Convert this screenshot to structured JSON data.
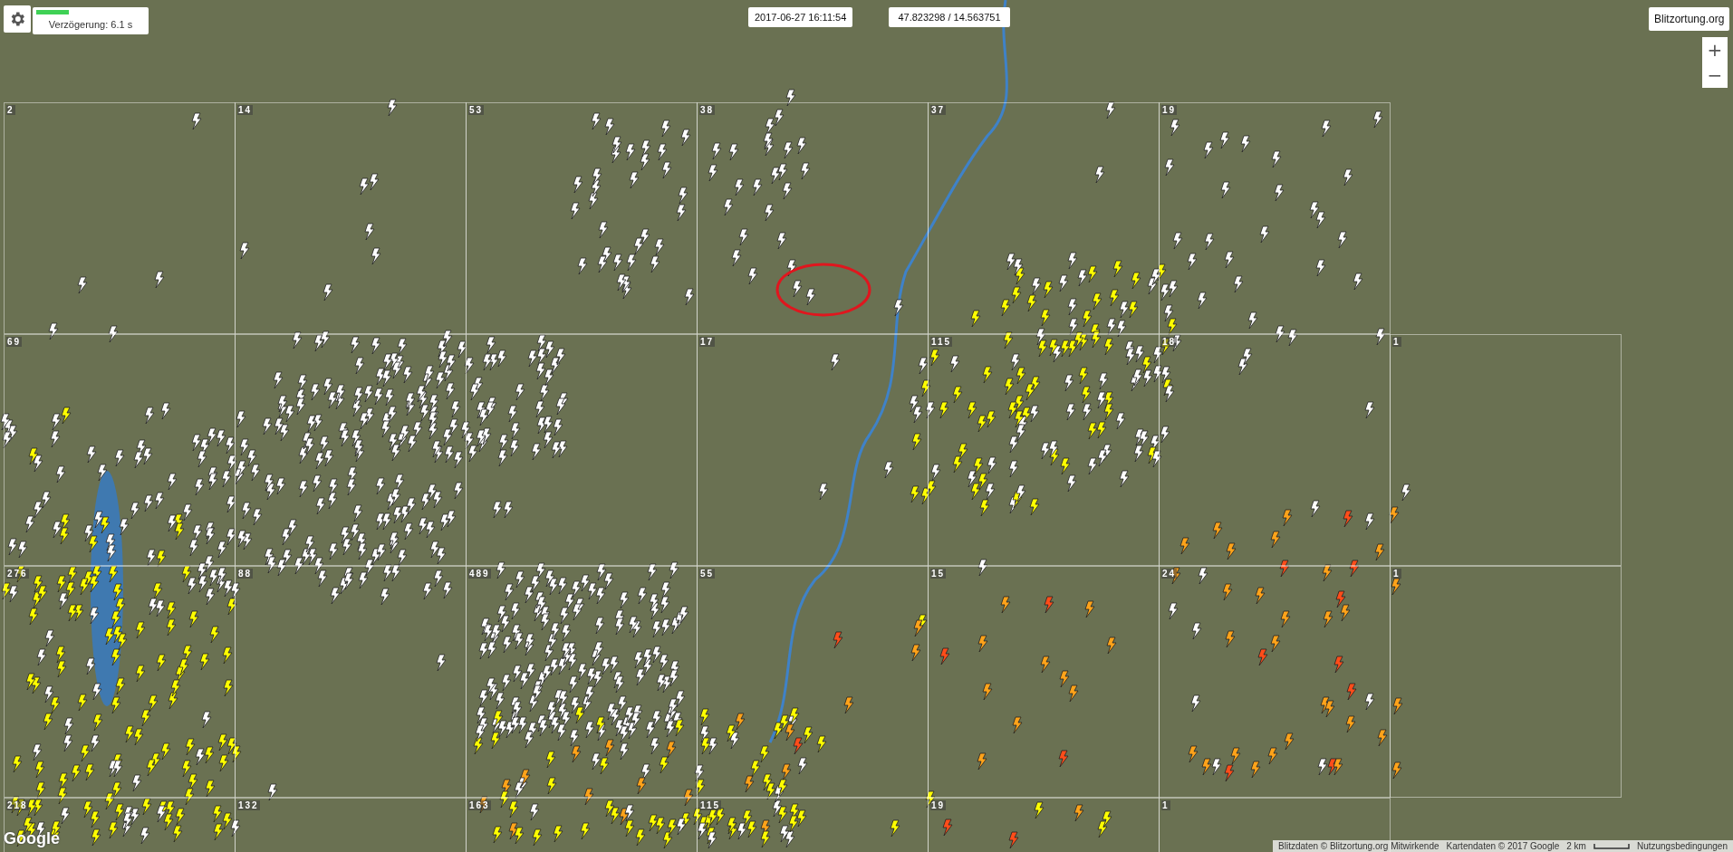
{
  "delay": {
    "label": "Verzögerung: 6.1 s",
    "level": 0.3
  },
  "timestamp": "2017-06-27 16:11:54",
  "coordinates": "47.823298 / 14.563751",
  "brand": "Blitzortung.org",
  "zoom_buttons": [
    "+",
    "−"
  ],
  "grid": {
    "rows": [
      {
        "cells": [
          {
            "count": "2"
          },
          {
            "count": "14"
          },
          {
            "count": "53"
          },
          {
            "count": "38"
          },
          {
            "count": "37"
          },
          {
            "count": "19"
          }
        ]
      },
      {
        "cells": [
          {
            "count": "69"
          },
          {},
          {},
          {
            "count": "17"
          },
          {
            "count": "115"
          },
          {
            "count": "18"
          },
          {
            "count": "1"
          }
        ]
      },
      {
        "cells": [
          {
            "count": "276"
          },
          {
            "count": "88"
          },
          {
            "count": "489"
          },
          {
            "count": "55"
          },
          {
            "count": "15"
          },
          {
            "count": "24"
          },
          {
            "count": "1"
          }
        ]
      },
      {
        "cells": [
          {
            "count": "218"
          },
          {
            "count": "132"
          },
          {
            "count": "163"
          },
          {
            "count": "115"
          },
          {
            "count": "19"
          },
          {
            "count": "1"
          }
        ]
      }
    ]
  },
  "map_logo": "Google",
  "attribution": [
    {
      "kind": "text",
      "text": "Blitzdaten © Blitzortung.org Mitwirkende"
    },
    {
      "kind": "text",
      "text": "Kartendaten © 2017 Google"
    },
    {
      "kind": "scale",
      "text": "2 km"
    },
    {
      "kind": "link",
      "text": "Nutzungsbedingungen"
    }
  ]
}
